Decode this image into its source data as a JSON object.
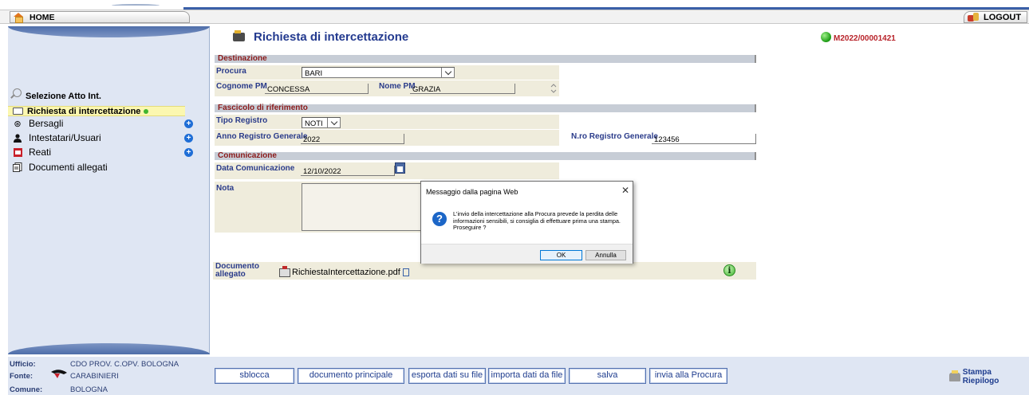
{
  "header": {
    "home_label": "HOME",
    "logout_label": "LOGOUT"
  },
  "sidebar": {
    "title": "Selezione Atto Int.",
    "active_item": "Richiesta di intercettazione",
    "items": [
      {
        "label": "Bersagli",
        "icon": "target-icon"
      },
      {
        "label": "Intestatari/Usuari",
        "icon": "user-icon"
      },
      {
        "label": "Reati",
        "icon": "reati-icon"
      },
      {
        "label": "Documenti allegati",
        "icon": "documents-icon"
      }
    ]
  },
  "footer": {
    "ufficio_label": "Ufficio:",
    "ufficio_value": "CDO PROV. C.OPV. BOLOGNA",
    "fonte_label": "Fonte:",
    "fonte_value": "CARABINIERI",
    "comune_label": "Comune:",
    "comune_value": "BOLOGNA"
  },
  "main": {
    "title": "Richiesta di intercettazione",
    "procedure_code": "M2022/00001421",
    "sections": {
      "destinazione": "Destinazione",
      "fascicolo": "Fascicolo di riferimento",
      "comunicazione": "Comunicazione"
    },
    "fields": {
      "procura_label": "Procura",
      "procura_value": "BARI",
      "cognome_label": "Cognome PM",
      "cognome_value": "CONCESSA",
      "nome_label": "Nome PM",
      "nome_value": "GRAZIA",
      "tipo_registro_label": "Tipo Registro",
      "tipo_registro_value": "NOTI",
      "anno_label": "Anno Registro Generale",
      "anno_value": "2022",
      "nro_label": "N.ro Registro Generale",
      "nro_value": "123456",
      "data_label": "Data Comunicazione",
      "data_value": "12/10/2022",
      "nota_label": "Nota",
      "nota_value": ""
    },
    "documento_label_1": "Documento",
    "documento_label_2": "allegato",
    "documento_file": "RichiestaIntercettazione.pdf"
  },
  "dialog": {
    "title": "Messaggio dalla pagina Web",
    "message": "L'invio della intercettazione alla Procura prevede la perdita delle informazioni sensibili, si consiglia di effettuare prima una stampa. Proseguire ?",
    "ok_label": "OK",
    "cancel_label": "Annulla"
  },
  "toolbar": {
    "sblocca": "sblocca",
    "documento_principale": "documento principale",
    "esporta": "esporta dati su file",
    "importa": "importa dati da file",
    "salva": "salva",
    "invia": "invia alla Procura",
    "stampa": "Stampa Riepilogo"
  }
}
